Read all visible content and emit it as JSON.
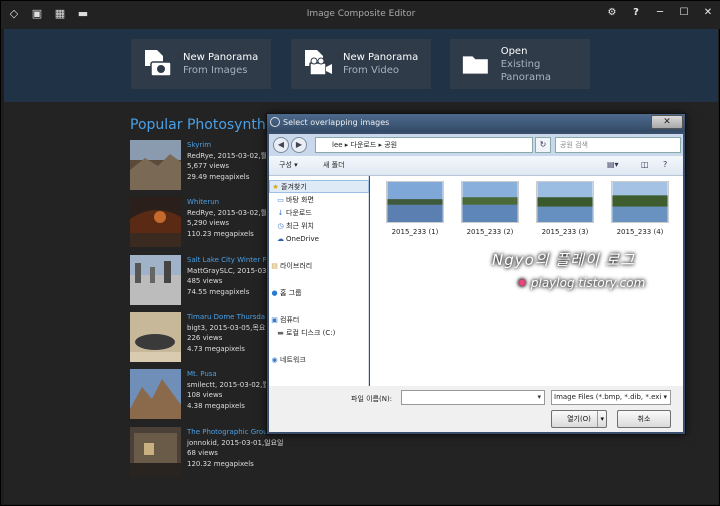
{
  "app": {
    "title": "Image Composite Editor",
    "title_icons": [
      "cube-icon",
      "new-doc-icon",
      "grid-icon",
      "folder-icon"
    ],
    "controls": [
      "⚙",
      "?",
      "─",
      "☐",
      "✕"
    ]
  },
  "actions": [
    {
      "title": "New Panorama",
      "subtitle": "From Images",
      "icon": "camera-icon"
    },
    {
      "title": "New Panorama",
      "subtitle": "From Video",
      "icon": "video-icon"
    },
    {
      "title": "Open",
      "subtitle": "Existing Panorama",
      "icon": "folder-icon"
    }
  ],
  "section_title": "Popular Photosynth.ne",
  "panoramas": [
    {
      "name": "Skyrim",
      "author": "RedRye, 2015-03-02,월",
      "views": "5,677 views",
      "megapixels": "29.49 megapixels"
    },
    {
      "name": "Whiterun",
      "author": "RedRye, 2015-03-02,월",
      "views": "5,290 views",
      "megapixels": "110.23 megapixels"
    },
    {
      "name": "Salt Lake City Winter P",
      "author": "MattGraySLC, 2015-03-",
      "views": "485 views",
      "megapixels": "74.55 megapixels"
    },
    {
      "name": "Timaru Dome Thursda",
      "author": "bigt3, 2015-03-05,목요",
      "views": "226 views",
      "megapixels": "4.73 megapixels"
    },
    {
      "name": "Mt. Pusa",
      "author": "smilectt, 2015-03-02,월",
      "views": "108 views",
      "megapixels": "4.38 megapixels"
    },
    {
      "name": "The Photographic Grou",
      "author": "jonnokid, 2015-03-01,일요일",
      "views": "68 views",
      "megapixels": "120.32 megapixels"
    }
  ],
  "dialog": {
    "title": "Select overlapping images",
    "close": "✕",
    "path": "lee ▸ 다운로드 ▸ 공원",
    "search_placeholder": "공원 검색",
    "toolbar": {
      "organize": "구성 ▾",
      "new_folder": "새 폴더"
    },
    "nav": [
      {
        "label": "즐겨찾기",
        "icon": "★"
      },
      {
        "label": "바탕 화면",
        "icon": "▭"
      },
      {
        "label": "다운로드",
        "icon": "↓"
      },
      {
        "label": "최근 위치",
        "icon": "◷"
      },
      {
        "label": "OneDrive",
        "icon": "☁"
      },
      {
        "label": "라이브러리",
        "icon": "▤"
      },
      {
        "label": "홈 그룹",
        "icon": "●"
      },
      {
        "label": "컴퓨터",
        "icon": "▣"
      },
      {
        "label": "로컬 디스크 (C:)",
        "icon": "▬"
      },
      {
        "label": "네트워크",
        "icon": "◉"
      }
    ],
    "files": [
      {
        "name": "2015_233 (1)"
      },
      {
        "name": "2015_233 (2)"
      },
      {
        "name": "2015_233 (3)"
      },
      {
        "name": "2015_233 (4)"
      }
    ],
    "filename_label": "파일 이름(N):",
    "filename_value": "",
    "file_type": "Image Files (*.bmp, *.dib, *.exi",
    "open_label": "열기(O)",
    "cancel_label": "취소"
  },
  "watermark": {
    "line1": "Ngyo의 플레이 로그",
    "line2": "playlog.tistory.com"
  }
}
